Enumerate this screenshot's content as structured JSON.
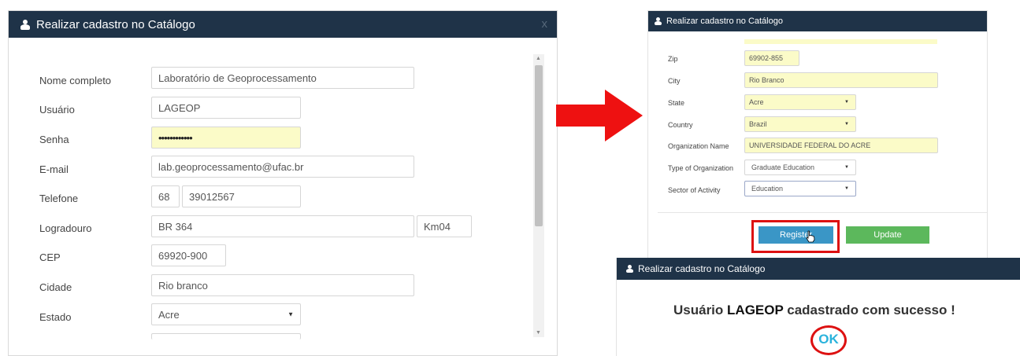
{
  "left_modal": {
    "title": "Realizar cadastro no Catálogo",
    "close_label": "x",
    "fields": {
      "nome_label": "Nome completo",
      "nome_value": "Laboratório de Geoprocessamento",
      "usuario_label": "Usuário",
      "usuario_value": "LAGEOP",
      "senha_label": "Senha",
      "senha_value": "••••••••••••",
      "email_label": "E-mail",
      "email_value": "lab.geoprocessamento@ufac.br",
      "telefone_label": "Telefone",
      "telefone_ddd": "68",
      "telefone_value": "39012567",
      "logradouro_label": "Logradouro",
      "logradouro_value": "BR 364",
      "logradouro_numero": "Km04",
      "cep_label": "CEP",
      "cep_value": "69920-900",
      "cidade_label": "Cidade",
      "cidade_value": "Rio branco",
      "estado_label": "Estado",
      "estado_value": "Acre"
    }
  },
  "right_modal": {
    "title": "Realizar cadastro no Catálogo",
    "fields": {
      "zip_label": "Zip",
      "zip_value": "69902-855",
      "city_label": "City",
      "city_value": "Rio Branco",
      "state_label": "State",
      "state_value": "Acre",
      "country_label": "Country",
      "country_value": "Brazil",
      "org_name_label": "Organization Name",
      "org_name_value": "UNIVERSIDADE FEDERAL DO ACRE",
      "org_type_label": "Type of Organization",
      "org_type_value": "Graduate Education",
      "sector_label": "Sector of Activity",
      "sector_value": "Education"
    },
    "register_label": "Register",
    "update_label": "Update"
  },
  "success_modal": {
    "title": "Realizar cadastro no Catálogo",
    "message_prefix": "Usuário",
    "message_user": "LAGEOP",
    "message_suffix": "cadastrado com sucesso !",
    "ok_label": "OK"
  },
  "colors": {
    "header": "#1f3348",
    "highlight_yellow": "#fbfbc8",
    "arrow_red": "#ee1111",
    "register_blue": "#3a96c6",
    "update_green": "#5cb85c",
    "ok_cyan": "#2ab3dc"
  }
}
